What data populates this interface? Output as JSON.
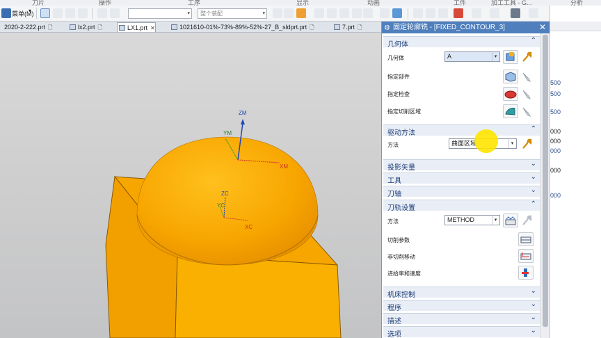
{
  "ribbon": {
    "group_labels": [
      "刀片",
      "操作",
      "工序",
      "显示",
      "动画",
      "工件",
      "加工工具 - G...",
      "分析"
    ]
  },
  "toolbar": {
    "menu_label": "菜单(M)",
    "combo1_value": "",
    "combo2_placeholder": "整个装配"
  },
  "tabs": [
    {
      "label": "2020-2-222.prt"
    },
    {
      "label": "lx2.prt"
    },
    {
      "label": "LX1.prt"
    },
    {
      "label": "1021610-01%-73%-89%-52%-27_B_sldprt.prt"
    },
    {
      "label": "7.prt"
    }
  ],
  "viewport": {
    "axis_labels": {
      "zm": "ZM",
      "ym": "YM",
      "xm": "XM",
      "zc": "ZC",
      "yc": "YC",
      "xc": "XC"
    },
    "colors": {
      "part_orange": "#f7a900",
      "part_edge": "#8a5a00",
      "axis_blue": "#1f46b6",
      "axis_red": "#d9452b",
      "axis_green": "#3a9a3a"
    }
  },
  "dialog": {
    "title": "固定轮廓铣 - [FIXED_CONTOUR_3]",
    "sections": {
      "geometry": {
        "header": "几何体",
        "geometry_label": "几何体",
        "geometry_value": "A",
        "specify_part": "指定部件",
        "specify_check": "指定检查",
        "specify_cut_area": "指定切削区域"
      },
      "drive_method": {
        "header": "驱动方法",
        "method_label": "方法",
        "method_value": "曲面区域"
      },
      "projection_vector": {
        "header": "投影矢量"
      },
      "tool": {
        "header": "工具"
      },
      "tool_axis": {
        "header": "刀轴"
      },
      "path_settings": {
        "header": "刀轨设置",
        "method_label": "方法",
        "method_value": "METHOD",
        "cut_params": "切削参数",
        "non_cut_moves": "非切削移动",
        "feeds_speeds": "进给率和速度"
      },
      "machine_control": {
        "header": "机床控制"
      },
      "program": {
        "header": "程序"
      },
      "description": {
        "header": "描述"
      },
      "options": {
        "header": "选项"
      }
    }
  },
  "right_strip": {
    "values": [
      "500",
      "500",
      "500",
      "000",
      "000",
      "000",
      "000",
      "000"
    ]
  }
}
